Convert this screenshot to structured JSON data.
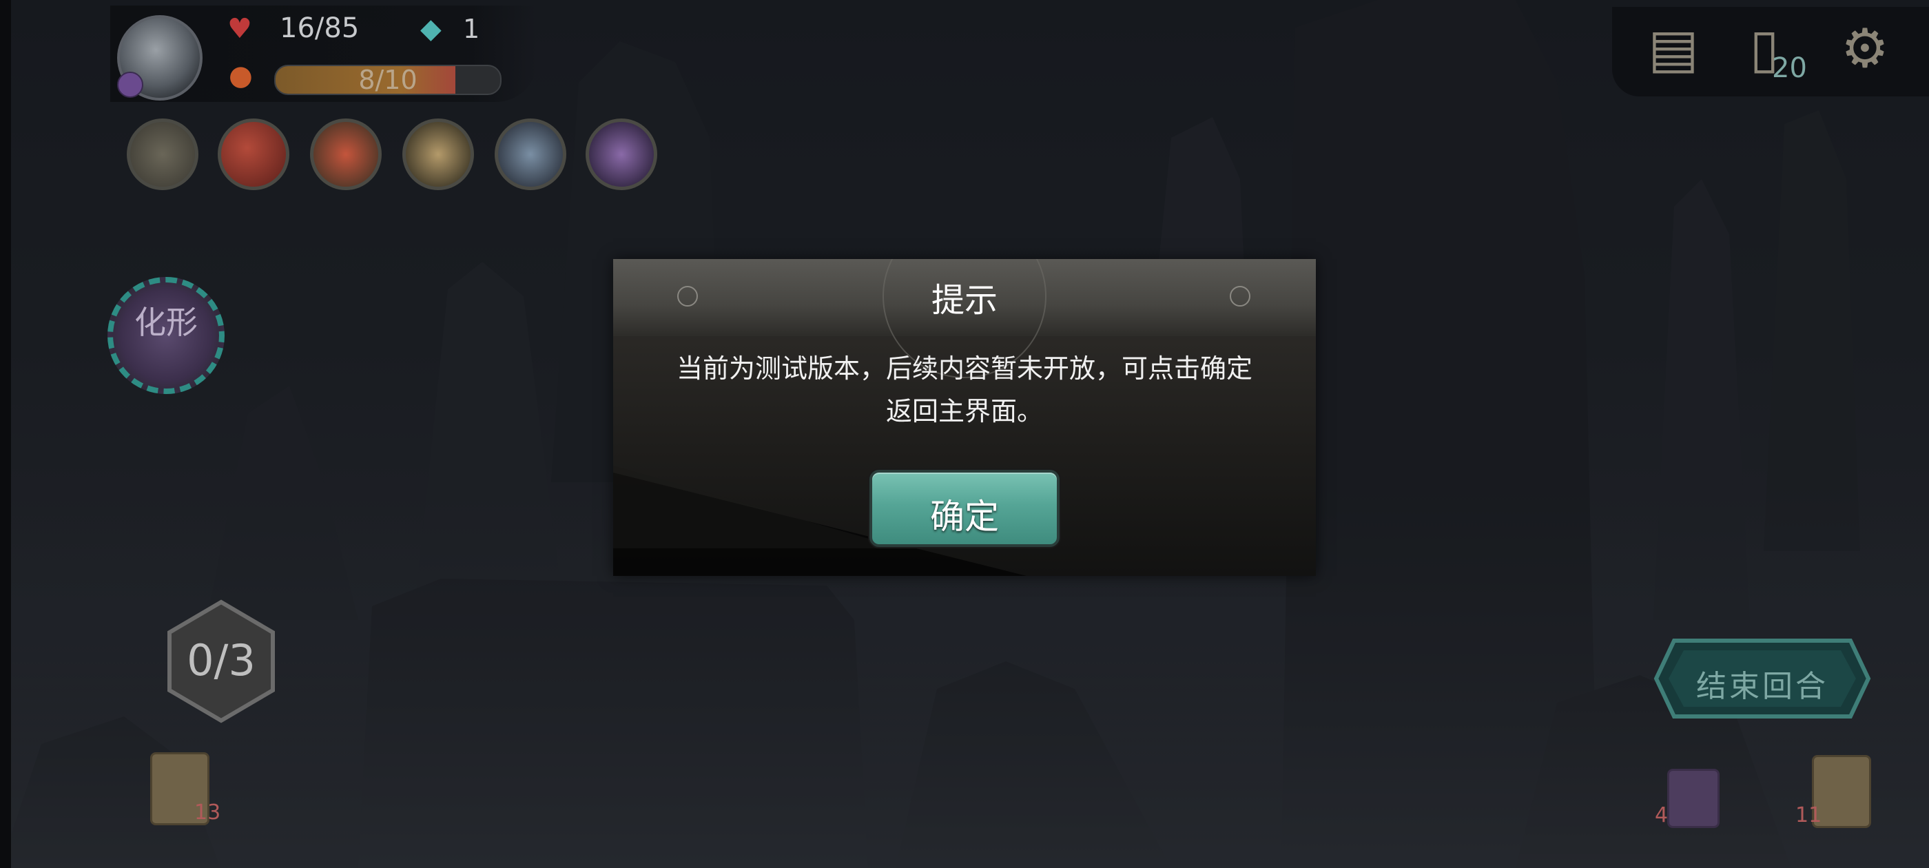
{
  "hud": {
    "hp": "16/85",
    "gems": "1",
    "energy": "8/10",
    "energy_fraction": 0.8,
    "icons": [
      "heart-icon",
      "crystal-icon",
      "energy-icon"
    ]
  },
  "relics": [
    "relic-mask-icon",
    "relic-red-orb-icon",
    "relic-bowl-icon",
    "relic-bell-icon",
    "relic-compass-icon",
    "relic-talisman-icon"
  ],
  "skill_badge": {
    "label": "化形",
    "icon": "skill-badge-icon"
  },
  "action_counter": "0/3",
  "toolbar": {
    "map_icon": "map-scroll-icon",
    "deck_icon": "card-deck-icon",
    "deck_count": "20",
    "settings_icon": "gear-icon"
  },
  "end_turn": {
    "label": "结束回合"
  },
  "piles": {
    "draw_count": "13",
    "exhaust_count": "4",
    "discard_count": "11"
  },
  "dialog": {
    "title": "提示",
    "message_line1": "当前为测试版本，后续内容暂未开放，可点击确定",
    "message_line2": "返回主界面。",
    "confirm_label": "确定"
  },
  "colors": {
    "accent_teal": "#55a596",
    "hp_red": "#c03a3a",
    "energy_orange": "#9a6a2e"
  }
}
